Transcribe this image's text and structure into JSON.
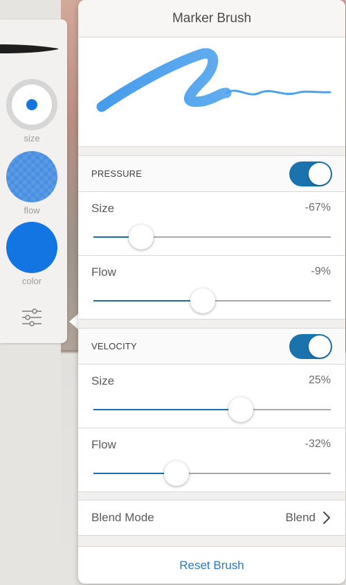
{
  "panel": {
    "title": "Marker Brush",
    "pressure": {
      "label": "PRESSURE",
      "enabled": true,
      "size": {
        "label": "Size",
        "value": "-67%",
        "position": 0.2
      },
      "flow": {
        "label": "Flow",
        "value": "-9%",
        "position": 0.46
      }
    },
    "velocity": {
      "label": "VELOCITY",
      "enabled": true,
      "size": {
        "label": "Size",
        "value": "25%",
        "position": 0.62
      },
      "flow": {
        "label": "Flow",
        "value": "-32%",
        "position": 0.35
      }
    },
    "blend": {
      "label": "Blend Mode",
      "value": "Blend"
    },
    "reset_label": "Reset Brush"
  },
  "tools": {
    "size_label": "size",
    "flow_label": "flow",
    "color_label": "color",
    "brush_color": "#1275e1",
    "icons": [
      "brush-preview-icon",
      "size-icon",
      "flow-swatch-icon",
      "color-swatch-icon",
      "sliders-icon",
      "chevron-right-icon"
    ]
  },
  "colors": {
    "accent": "#1b73ae",
    "link": "#2a7ac1",
    "stroke": "#3f9cec"
  }
}
